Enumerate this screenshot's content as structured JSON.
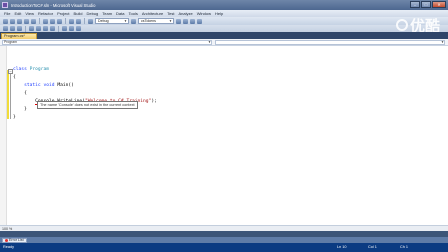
{
  "window": {
    "title": "IntroductionToC#.sln - Microsoft Visual Studio"
  },
  "menu": {
    "items": [
      "File",
      "Edit",
      "View",
      "Refactor",
      "Project",
      "Build",
      "Debug",
      "Team",
      "Data",
      "Tools",
      "Architecture",
      "Test",
      "Analyze",
      "Window",
      "Help"
    ]
  },
  "toolbar": {
    "config": "Debug",
    "platform": "csTokens"
  },
  "watermark": {
    "text": "优酷"
  },
  "tabs": {
    "active": "Program.cs*"
  },
  "navbar": {
    "class_combo": "Program",
    "member_combo": ""
  },
  "code": {
    "line1_kw": "class",
    "line1_name": "Program",
    "line2": "{",
    "line3_kw1": "static",
    "line3_kw2": "void",
    "line3_name": "Main()",
    "line4": "{",
    "line5_obj": "Console",
    "line5_call": ".WriteLine(",
    "line5_str": "\"Welcome to C# Training\"",
    "line5_end": ");",
    "line6": "}",
    "line7": "}"
  },
  "tooltip": {
    "text": "The name 'Console' does not exist in the current context"
  },
  "editor_status": {
    "zoom": "100 %"
  },
  "error_list": {
    "label": "Error List"
  },
  "statusbar": {
    "message": "Ready",
    "line": "Ln 10",
    "col": "Col 1",
    "ch": "Ch 1"
  },
  "colors": {
    "keyword": "#1f3fff",
    "type": "#2b91af",
    "string": "#a31515",
    "statusbar": "#0b3b82"
  }
}
